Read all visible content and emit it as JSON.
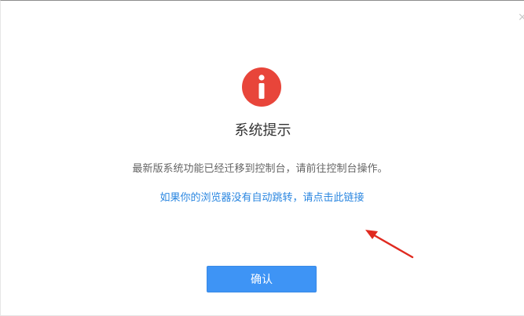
{
  "dialog": {
    "close_icon": "×",
    "icon": "info-icon",
    "title": "系统提示",
    "message": "最新版系统功能已经迁移到控制台，请前往控制台操作。",
    "link_text": "如果你的浏览器没有自动跳转，请点击此链接",
    "confirm_label": "确认"
  },
  "colors": {
    "icon_red": "#e8453a",
    "link_blue": "#2a86e0",
    "button_blue": "#3e94f5",
    "arrow_red": "#e02a20"
  }
}
